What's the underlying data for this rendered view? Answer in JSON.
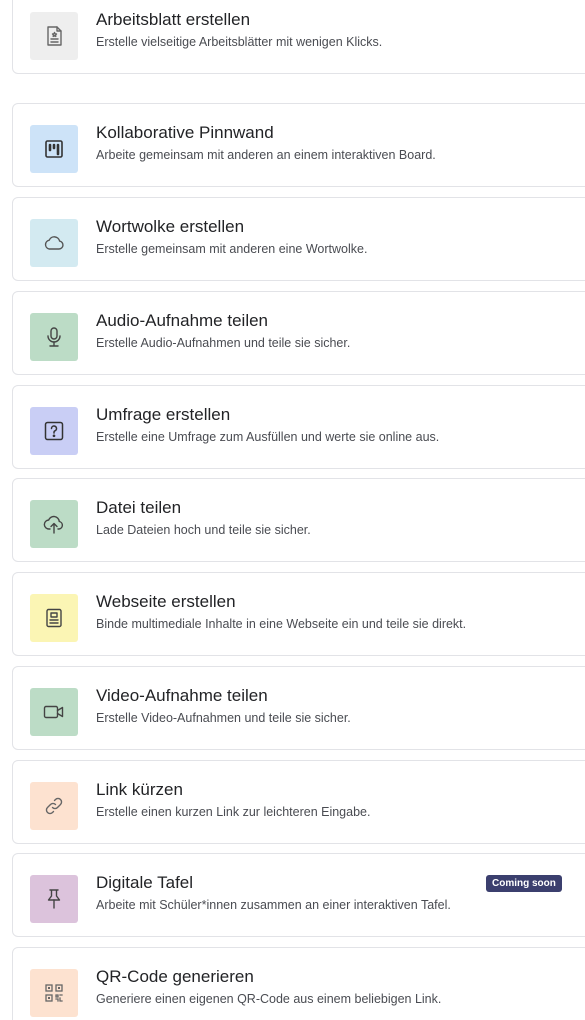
{
  "items": [
    {
      "title": "Arbeitsblatt erstellen",
      "description": "Erstelle vielseitige Arbeitsblätter mit wenigen Klicks.",
      "icon": "worksheet-icon",
      "color": "#eeeeee",
      "stroke": "#666666"
    },
    {
      "title": "Kollaborative Pinnwand",
      "description": "Arbeite gemeinsam mit anderen an einem interaktiven Board.",
      "icon": "board-icon",
      "color": "#cde3f8",
      "stroke": "#333333"
    },
    {
      "title": "Wortwolke erstellen",
      "description": "Erstelle gemeinsam mit anderen eine Wortwolke.",
      "icon": "cloud-icon",
      "color": "#d3eaf1",
      "stroke": "#555555"
    },
    {
      "title": "Audio-Aufnahme teilen",
      "description": "Erstelle Audio-Aufnahmen und teile sie sicher.",
      "icon": "microphone-icon",
      "color": "#bcdcc6",
      "stroke": "#444444"
    },
    {
      "title": "Umfrage erstellen",
      "description": "Erstelle eine Umfrage zum Ausfüllen und werte sie online aus.",
      "icon": "question-icon",
      "color": "#c9cef5",
      "stroke": "#333333"
    },
    {
      "title": "Datei teilen",
      "description": "Lade Dateien hoch und teile sie sicher.",
      "icon": "cloud-upload-icon",
      "color": "#bcdcc6",
      "stroke": "#444444"
    },
    {
      "title": "Webseite erstellen",
      "description": "Binde multimediale Inhalte in eine Webseite ein und teile sie direkt.",
      "icon": "webpage-icon",
      "color": "#fbf5b4",
      "stroke": "#444444"
    },
    {
      "title": "Video-Aufnahme teilen",
      "description": "Erstelle Video-Aufnahmen und teile sie sicher.",
      "icon": "video-camera-icon",
      "color": "#bcdcc6",
      "stroke": "#444444"
    },
    {
      "title": "Link kürzen",
      "description": "Erstelle einen kurzen Link zur leichteren Eingabe.",
      "icon": "link-icon",
      "color": "#fde2d0",
      "stroke": "#666666"
    },
    {
      "title": "Digitale Tafel",
      "description": "Arbeite mit Schüler*innen zusammen an einer interaktiven Tafel.",
      "icon": "pin-icon",
      "color": "#dcc3dc",
      "stroke": "#444444",
      "badge": "Coming soon"
    },
    {
      "title": "QR-Code generieren",
      "description": "Generiere einen eigenen QR-Code aus einem beliebigen Link.",
      "icon": "qr-code-icon",
      "color": "#fde2d0",
      "stroke": "#666666"
    }
  ]
}
